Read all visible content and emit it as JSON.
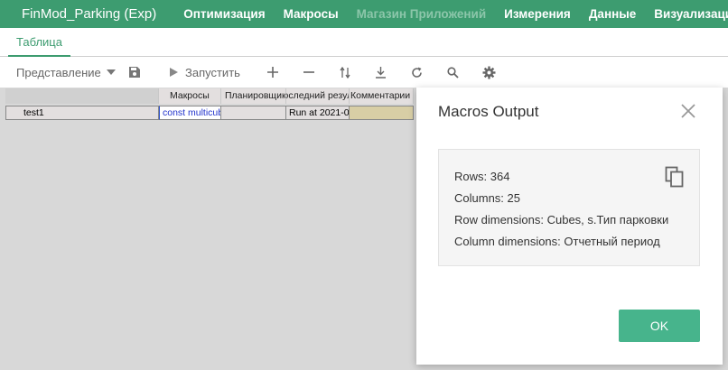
{
  "app": {
    "title": "FinMod_Parking (Exp)"
  },
  "nav": [
    {
      "label": "Оптимизация",
      "enabled": true
    },
    {
      "label": "Макросы",
      "enabled": true
    },
    {
      "label": "Магазин Приложений",
      "enabled": false
    },
    {
      "label": "Измерения",
      "enabled": true
    },
    {
      "label": "Данные",
      "enabled": true
    },
    {
      "label": "Визуализация",
      "enabled": true
    }
  ],
  "tabs": [
    {
      "label": "Таблица",
      "active": true
    }
  ],
  "toolbar": {
    "view_label": "Представление",
    "run_label": "Запустить"
  },
  "grid": {
    "headers": [
      "Макросы",
      "Планировщик",
      "Последний результат",
      "Комментарии"
    ],
    "rows": [
      {
        "name": "test1",
        "macro": "const multicube",
        "scheduler": "",
        "last_result": "Run at 2021-0",
        "comment": ""
      }
    ]
  },
  "dialog": {
    "title": "Macros Output",
    "rows_line": "Rows: 364",
    "columns_line": "Columns: 25",
    "row_dims_line": "Row dimensions: Cubes, s.Тип парковки",
    "col_dims_line": "Column dimensions: Отчетный период",
    "ok_label": "OK"
  },
  "colors": {
    "brand": "#3d9c70",
    "ok_button": "#47b48c"
  }
}
